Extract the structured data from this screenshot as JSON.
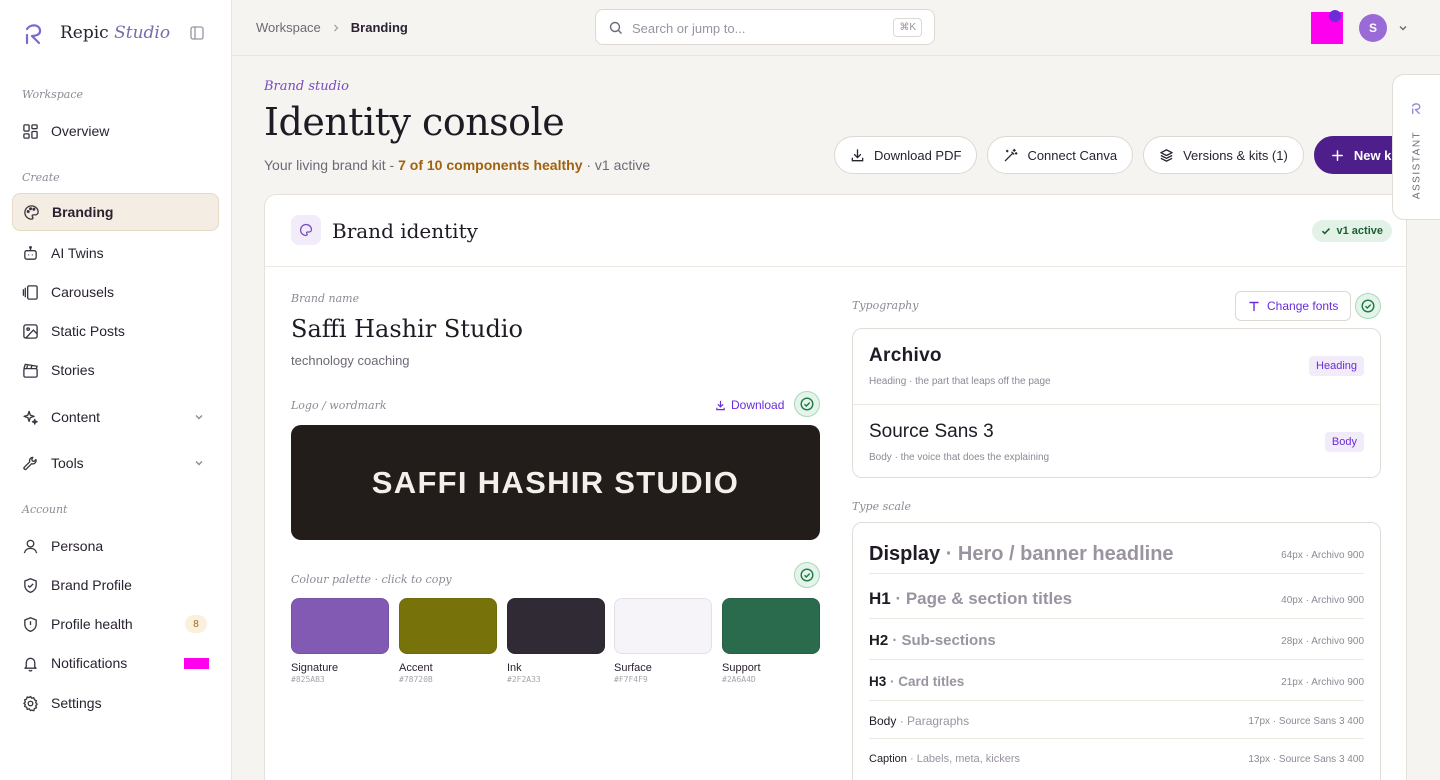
{
  "app": {
    "brand": "Repic",
    "brand_suffix": "Studio"
  },
  "sidebar": {
    "sections": [
      "Workspace",
      "Create",
      "Account"
    ],
    "items": [
      {
        "label": "Overview"
      },
      {
        "label": "Branding"
      },
      {
        "label": "AI Twins"
      },
      {
        "label": "Carousels"
      },
      {
        "label": "Static Posts"
      },
      {
        "label": "Stories"
      },
      {
        "label": "Content"
      },
      {
        "label": "Tools"
      },
      {
        "label": "Persona"
      },
      {
        "label": "Brand Profile"
      },
      {
        "label": "Profile health",
        "badge": "8"
      },
      {
        "label": "Notifications"
      },
      {
        "label": "Settings"
      }
    ]
  },
  "topbar": {
    "breadcrumb": [
      "Workspace",
      "Branding"
    ],
    "search_placeholder": "Search or jump to...",
    "shortcut": "⌘K",
    "avatar_initial": "S"
  },
  "assistant": {
    "label": "ASSISTANT"
  },
  "header": {
    "kicker": "Brand studio",
    "title": "Identity console",
    "subtitle_prefix": "Your living brand kit - ",
    "subtitle_highlight": "7 of 10 components healthy",
    "subtitle_suffix": " · v1 active"
  },
  "actions": {
    "download_pdf": "Download PDF",
    "connect_canva": "Connect Canva",
    "versions": "Versions & kits (1)",
    "new_kit": "New kit"
  },
  "card": {
    "title": "Brand identity",
    "status": "v1 active",
    "brand_name_label": "Brand name",
    "brand_name": "Saffi Hashir Studio",
    "brand_desc": "technology coaching",
    "logo_label": "Logo / wordmark",
    "logo_download": "Download",
    "logo_wordmark": "SAFFI HASHIR STUDIO",
    "palette_label": "Colour palette · click to copy",
    "palette": [
      {
        "name": "Signature",
        "hex": "#825AB3"
      },
      {
        "name": "Accent",
        "hex": "#78720B"
      },
      {
        "name": "Ink",
        "hex": "#2F2A33"
      },
      {
        "name": "Surface",
        "hex": "#F7F4F9"
      },
      {
        "name": "Support",
        "hex": "#2A6A4D"
      }
    ],
    "typography_label": "Typography",
    "change_fonts": "Change fonts",
    "fonts": [
      {
        "name": "Archivo",
        "desc": "Heading · the part that leaps off the page",
        "role": "Heading"
      },
      {
        "name": "Source Sans 3",
        "desc": "Body · the voice that does the explaining",
        "role": "Body"
      }
    ],
    "type_scale_label": "Type scale",
    "type_scale": [
      {
        "name": "Display",
        "sample": " · Hero / banner headline",
        "spec": "64px · Archivo 900"
      },
      {
        "name": "H1",
        "sample": " · Page & section titles",
        "spec": "40px · Archivo 900"
      },
      {
        "name": "H2",
        "sample": " · Sub-sections",
        "spec": "28px · Archivo 900"
      },
      {
        "name": "H3",
        "sample": " · Card titles",
        "spec": "21px · Archivo 900"
      },
      {
        "name": "Body",
        "sample": " · Paragraphs",
        "spec": "17px · Source Sans 3 400"
      },
      {
        "name": "Caption",
        "sample": " · Labels, meta, kickers",
        "spec": "13px · Source Sans 3 400"
      }
    ]
  }
}
